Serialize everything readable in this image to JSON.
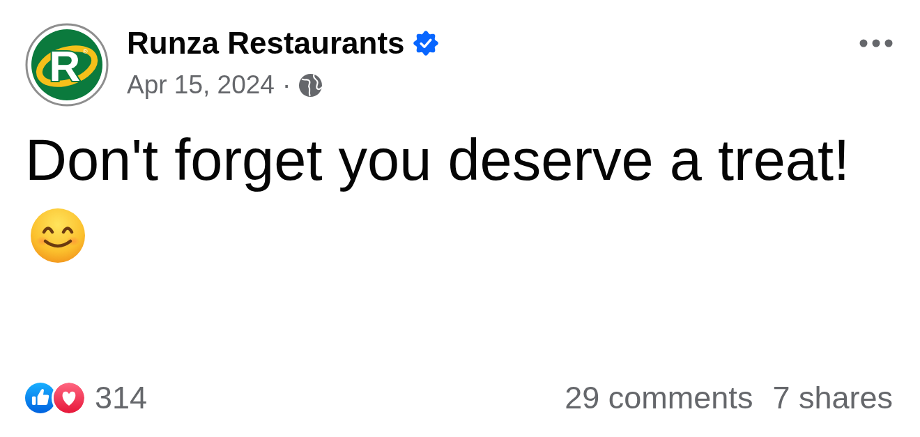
{
  "post": {
    "author": {
      "name": "Runza Restaurants",
      "verified": true,
      "logo_letter": "R",
      "logo_mark": "®"
    },
    "date": "Apr 15, 2024",
    "separator": "·",
    "message": "Don't forget you deserve a treat!",
    "reactions": {
      "types": [
        {
          "kind": "like"
        },
        {
          "kind": "love"
        }
      ],
      "count": "314"
    },
    "comments": "29 comments",
    "shares": "7 shares"
  }
}
